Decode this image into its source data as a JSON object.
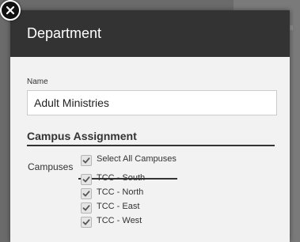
{
  "dialog": {
    "title": "Department",
    "close_icon": "close-icon"
  },
  "form": {
    "name_label": "Name",
    "name_value": "Adult Ministries",
    "section_title": "Campus Assignment",
    "campuses_label": "Campuses",
    "select_all": {
      "label": "Select All Campuses",
      "checked": true
    },
    "campuses": [
      {
        "label": "TCC - South",
        "checked": true
      },
      {
        "label": "TCC - North",
        "checked": true
      },
      {
        "label": "TCC - East",
        "checked": true
      },
      {
        "label": "TCC - West",
        "checked": true
      }
    ]
  },
  "colors": {
    "header_bg": "#333333",
    "dialog_bg": "#f2f2f2",
    "overlay": "#6b6b6b"
  }
}
